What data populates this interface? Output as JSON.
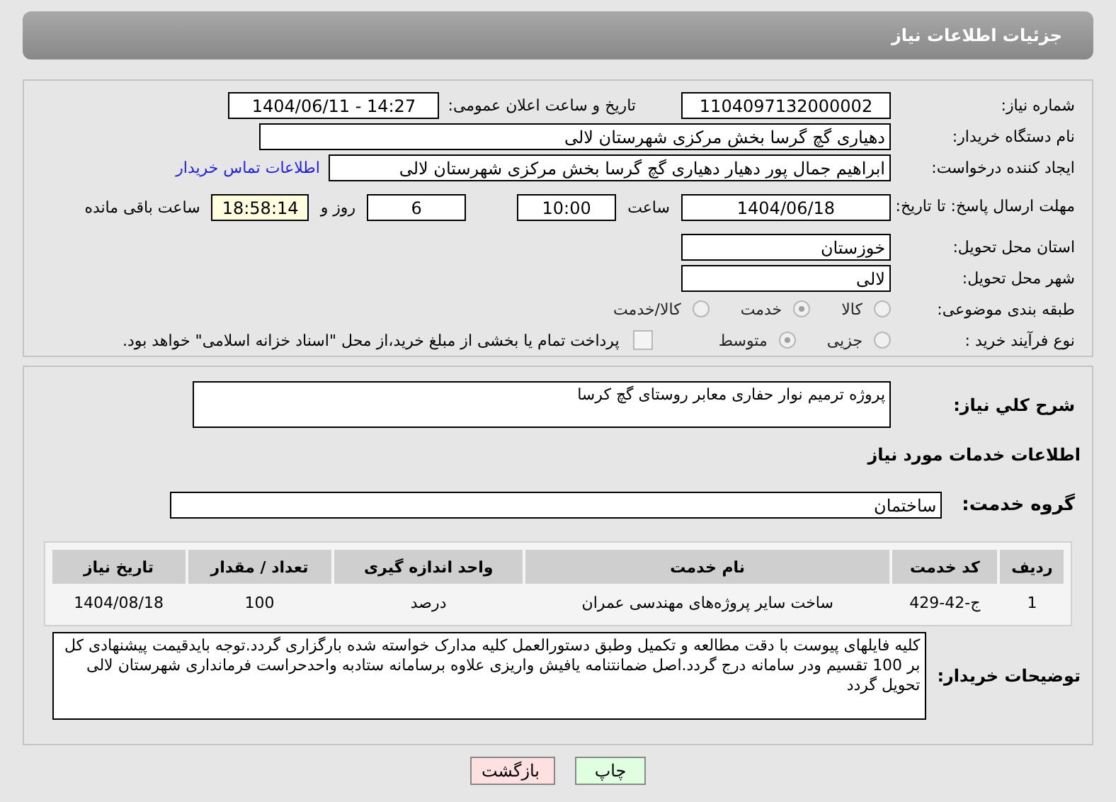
{
  "header": {
    "title": "جزئیات اطلاعات نیاز"
  },
  "need_number": {
    "label": "شماره نیاز:",
    "value": "1104097132000002"
  },
  "announce_date": {
    "label": "تاریخ و ساعت اعلان عمومی:",
    "value": "1404/06/11 - 14:27"
  },
  "buyer_org": {
    "label": "نام دستگاه خریدار:",
    "value": "دهیاری گچ گرسا بخش مرکزی شهرستان لالی"
  },
  "creator": {
    "label": "ایجاد کننده درخواست:",
    "value": "ابراهیم جمال پور دهیار دهیاری گچ گرسا بخش مرکزی شهرستان لالی",
    "link": "اطلاعات تماس خریدار"
  },
  "deadline": {
    "label": "مهلت ارسال پاسخ: تا تاریخ:",
    "date": "1404/06/18",
    "time_label": "ساعت",
    "time": "10:00",
    "days": "6",
    "days_label": "روز و",
    "remaining": "18:58:14",
    "remaining_label": "ساعت باقی مانده"
  },
  "province": {
    "label": "استان محل تحویل:",
    "value": "خوزستان"
  },
  "city": {
    "label": "شهر محل تحویل:",
    "value": "لالی"
  },
  "category": {
    "label": "طبقه بندی موضوعی:",
    "options": [
      {
        "label": "کالا",
        "selected": false
      },
      {
        "label": "خدمت",
        "selected": true
      },
      {
        "label": "کالا/خدمت",
        "selected": false
      }
    ]
  },
  "purchase_type": {
    "label": "نوع فرآیند خرید :",
    "options": [
      {
        "label": "جزیی",
        "selected": false
      },
      {
        "label": "متوسط",
        "selected": true
      }
    ],
    "payment": {
      "label": "پرداخت تمام یا بخشی از مبلغ خرید،از محل \"اسناد خزانه اسلامی\" خواهد بود.",
      "checked": false
    }
  },
  "description": {
    "label": "شرح کلي نیاز:",
    "value": "پروژه ترمیم نوار حفاری معابر روستای گچ کرسا"
  },
  "services_heading": "اطلاعات خدمات مورد نیاز",
  "service_group": {
    "label": "گروه خدمت:",
    "value": "ساختمان"
  },
  "table": {
    "columns": [
      "ردیف",
      "کد خدمت",
      "نام خدمت",
      "واحد اندازه گیری",
      "تعداد / مقدار",
      "تاریخ نیاز"
    ],
    "rows": [
      [
        "1",
        "ج-42-429",
        "ساخت سایر پروژه‌های مهندسی عمران",
        "درصد",
        "100",
        "1404/08/18"
      ]
    ]
  },
  "buyer_notes": {
    "label": "توضیحات خریدار:",
    "value": "کلیه فایلهای پیوست  با دقت مطالعه و تکمیل وطبق دستورالعمل کلیه مدارک خواسته شده بارگزاری گردد.توجه بایدقیمت پیشنهادی کل بر 100 تقسیم ودر سامانه درج گردد.اصل ضمانتنامه یافیش  واریزی علاوه برسامانه ستادبه واحدحراست فرمانداری شهرستان لالی  تحویل گردد"
  },
  "buttons": [
    {
      "label": "چاپ",
      "kind": "print"
    },
    {
      "label": "بازگشت",
      "kind": "back"
    }
  ]
}
